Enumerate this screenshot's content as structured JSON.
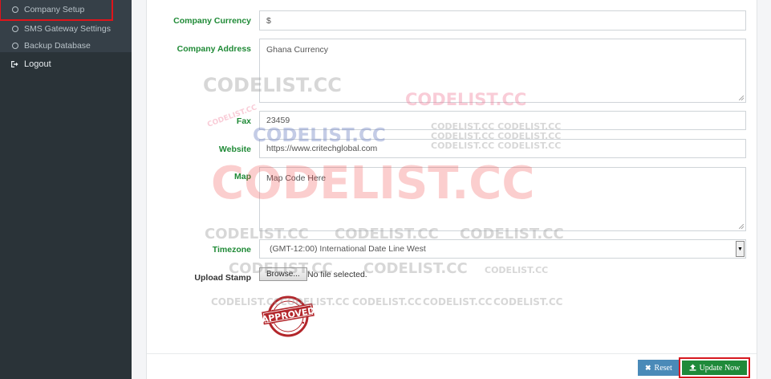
{
  "sidebar": {
    "submenu": [
      {
        "label": "Company Setup"
      },
      {
        "label": "SMS Gateway Settings"
      },
      {
        "label": "Backup Database"
      }
    ],
    "logout_label": "Logout"
  },
  "form": {
    "currency": {
      "label": "Company Currency",
      "value": "$"
    },
    "address": {
      "label": "Company Address",
      "value": "Ghana Currency"
    },
    "fax": {
      "label": "Fax",
      "value": "23459"
    },
    "website": {
      "label": "Website",
      "value": "https://www.critechglobal.com"
    },
    "map": {
      "label": "Map",
      "value": "Map Code Here"
    },
    "timezone": {
      "label": "Timezone",
      "value": "(GMT-12:00) International Date Line West"
    },
    "stamp": {
      "label": "Upload Stamp",
      "browse_label": "Browse...",
      "file_status": "No file selected.",
      "image_text": "APPROVED"
    }
  },
  "actions": {
    "reset_label": "Reset",
    "update_label": "Update Now"
  },
  "watermark": {
    "text": "CODELIST.CC",
    "small_line": "CODELIST.CC CODELIST.CC"
  },
  "colors": {
    "label_green": "#1f8a36",
    "update_green": "#1f8a3a",
    "reset_blue": "#4a8ab8",
    "highlight_red": "#e0141a",
    "sidebar_bg": "#2a3338"
  }
}
